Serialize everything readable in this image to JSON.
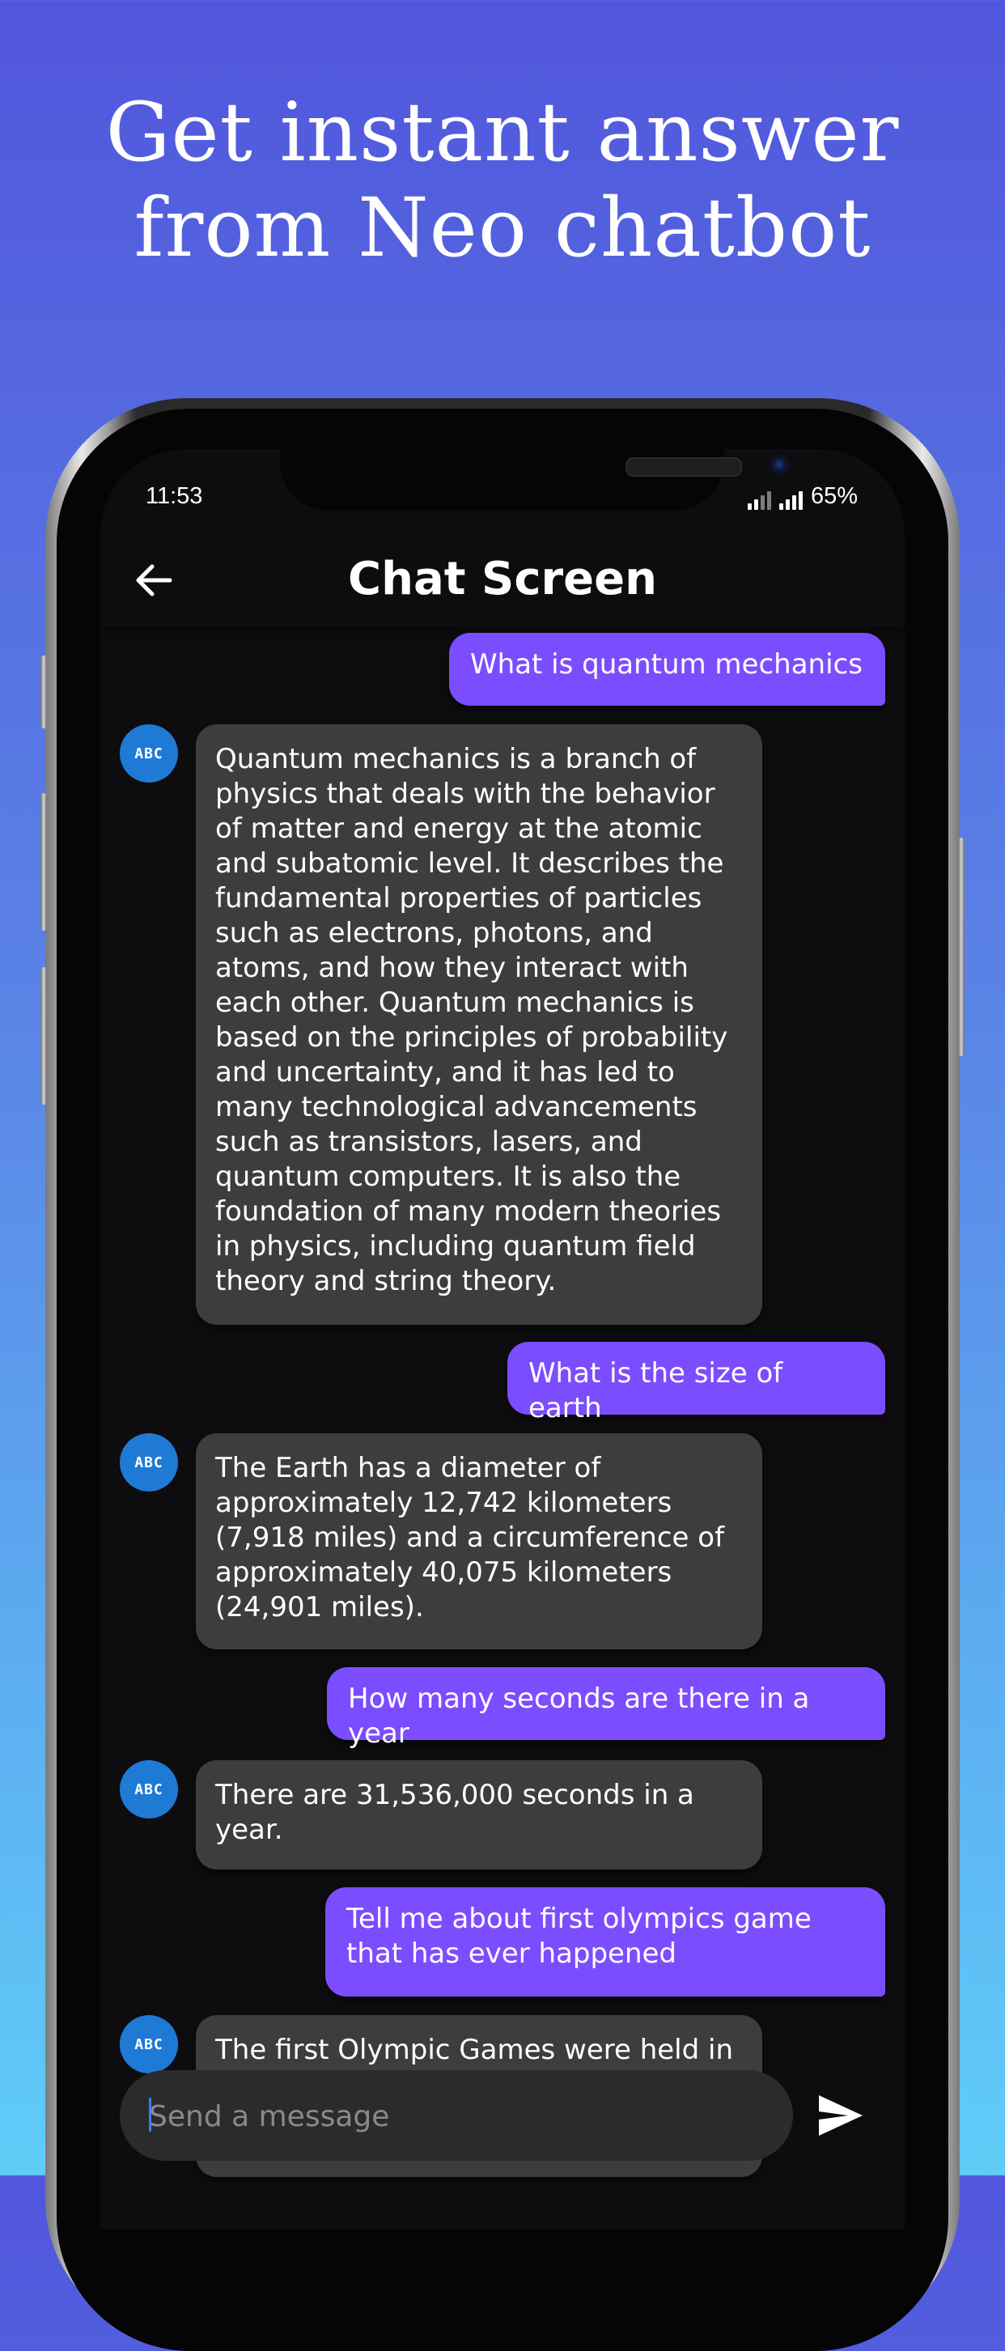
{
  "headline": {
    "line1": "Get instant answer",
    "line2": "from Neo chatbot"
  },
  "status_bar": {
    "time": "11:53",
    "battery": "65%"
  },
  "appbar": {
    "title": "Chat Screen",
    "back_icon": "arrow-left-icon"
  },
  "bot_avatar_label": "ABC",
  "messages": [
    {
      "sender": "user",
      "text": "What is quantum mechanics"
    },
    {
      "sender": "bot",
      "text": "Quantum mechanics is a branch of physics that deals with the behavior of matter and energy at the atomic and subatomic level. It describes the fundamental properties of particles such as electrons, photons, and atoms, and how they interact with each other. Quantum mechanics is based on the principles of probability and uncertainty, and it has led to many technological advancements such as transistors, lasers, and quantum computers. It is also the foundation of many modern theories in physics, including quantum field theory and string theory."
    },
    {
      "sender": "user",
      "text": "What is the size of earth"
    },
    {
      "sender": "bot",
      "text": "The Earth has a diameter of approximately 12,742 kilometers (7,918 miles) and a circumference of approximately 40,075 kilometers (24,901 miles)."
    },
    {
      "sender": "user",
      "text": "How many seconds are there in a year"
    },
    {
      "sender": "bot",
      "text": "There are 31,536,000 seconds in a year."
    },
    {
      "sender": "user",
      "text": "Tell me about first olympics game that has ever happened"
    },
    {
      "sender": "bot",
      "text": "The first Olympic Games were held in"
    }
  ],
  "composer": {
    "placeholder": "Send a message",
    "send_icon": "send-icon"
  },
  "colors": {
    "user_bubble": "#7c4dff",
    "bot_bubble": "#3d3d3f",
    "avatar": "#1f7ad6",
    "screen_bg": "#0d0d0f"
  }
}
